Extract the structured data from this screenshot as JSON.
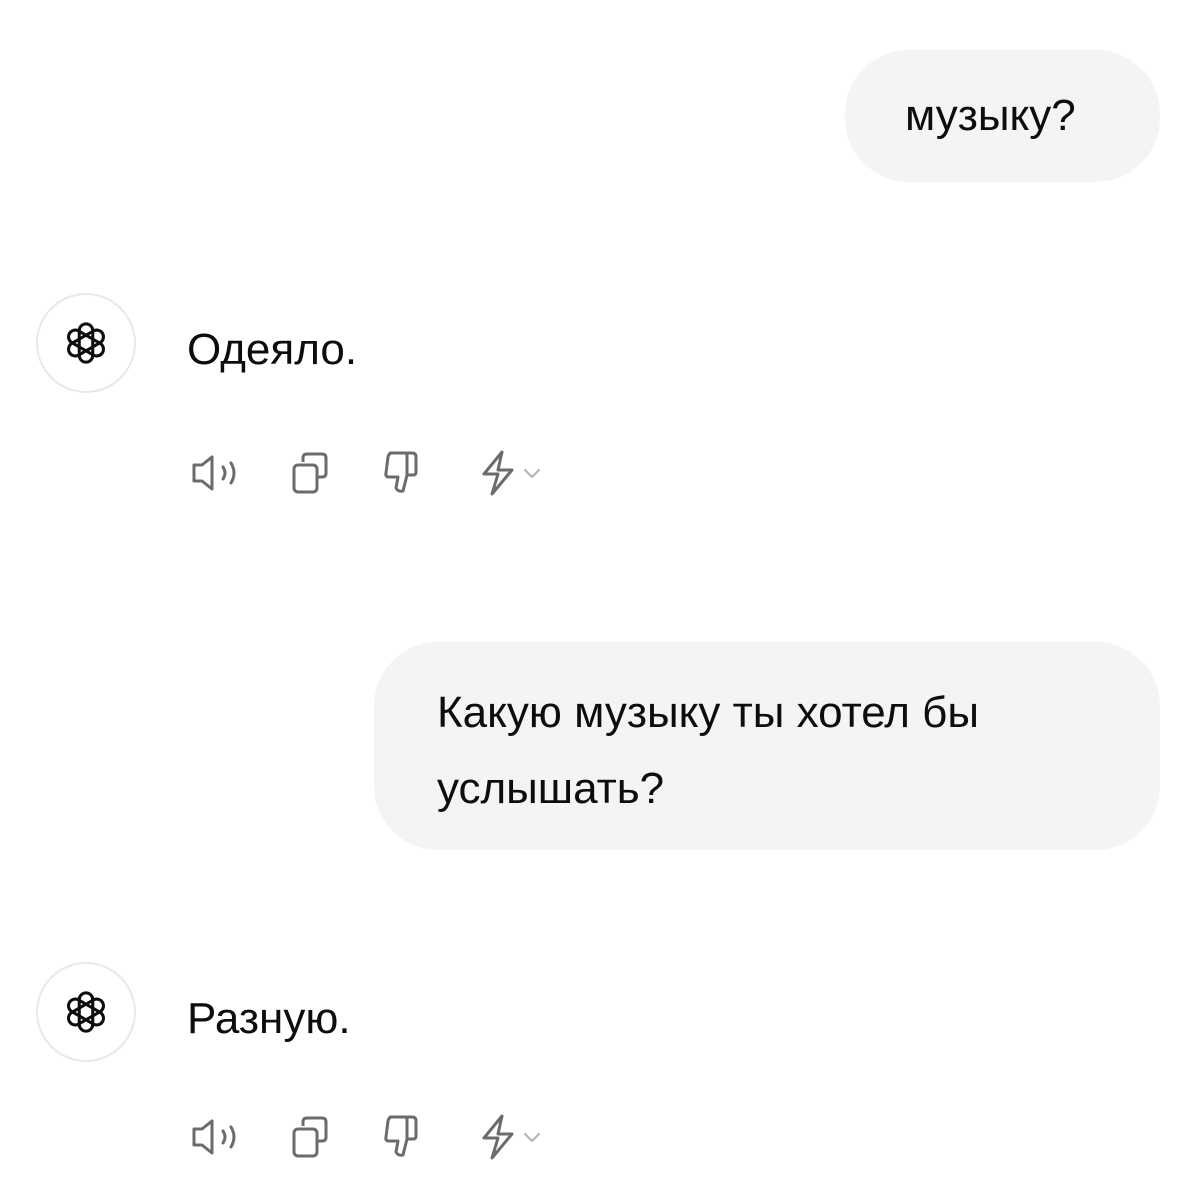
{
  "conversation": {
    "messages": [
      {
        "role": "user",
        "text": "музыку?"
      },
      {
        "role": "assistant",
        "text": "Одеяло."
      },
      {
        "role": "user",
        "text": "Какую музыку ты хотел бы\nуслышать?"
      },
      {
        "role": "assistant",
        "text": "Разную."
      }
    ]
  },
  "assistant": {
    "avatar_icon": "openai-logo-icon"
  },
  "action_bar": {
    "icons": [
      "speaker-icon",
      "copy-icon",
      "thumbs-down-icon",
      "lightning-icon",
      "chevron-down-icon"
    ]
  },
  "colors": {
    "bubble_bg": "#f4f4f4",
    "text": "#0d0d0d",
    "icon": "#6b6b6b",
    "chevron": "#b4b4b4"
  }
}
